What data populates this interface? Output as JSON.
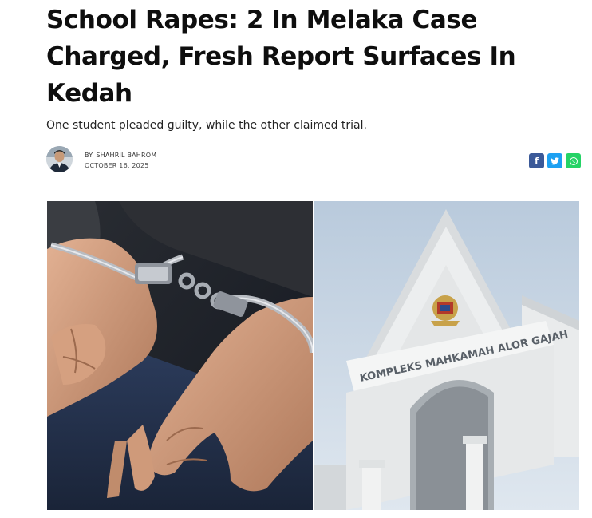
{
  "article": {
    "headline": "School Rapes: 2 In Melaka Case Charged, Fresh Report Surfaces In Kedah",
    "subheadline": "One student pleaded guilty, while the other claimed trial.",
    "byline": {
      "by": "BY",
      "author": "SHAHRIL BAHROM",
      "date": "OCTOBER 16, 2025"
    }
  },
  "share": [
    {
      "name": "facebook",
      "glyph": "f",
      "color": "#3b5998"
    },
    {
      "name": "twitter",
      "glyph": "t",
      "color": "#1da1f2"
    },
    {
      "name": "whatsapp",
      "glyph": "w",
      "color": "#25d366"
    }
  ],
  "photo": {
    "left_panel": "handcuffed-hands",
    "right_panel": "court-building",
    "building_sign": "KOMPLEKS MAHKAMAH ALOR GAJAH"
  }
}
